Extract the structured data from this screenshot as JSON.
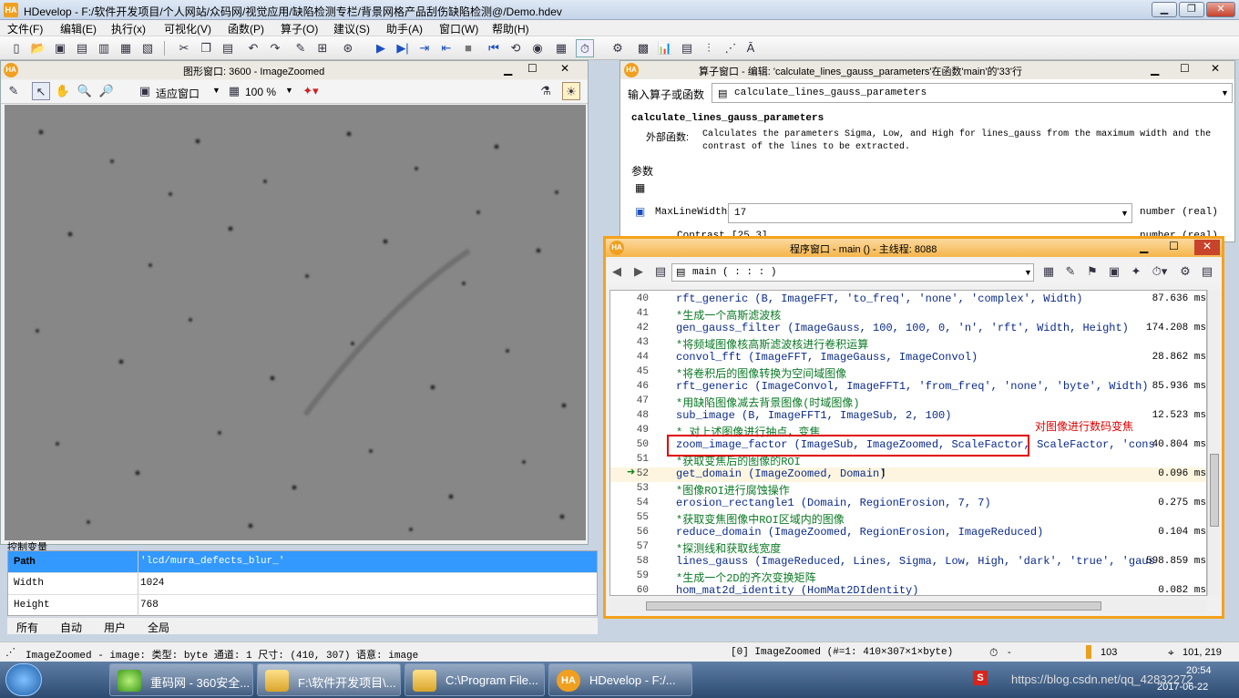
{
  "app": {
    "title": "HDevelop - F:/软件开发项目/个人网站/众码网/视觉应用/缺陷检测专栏/背景网格产品刮伤缺陷检测@/Demo.hdev",
    "logo": "HA"
  },
  "menu": [
    "文件(F)",
    "编辑(E)",
    "执行(x)",
    "可视化(V)",
    "函数(P)",
    "算子(O)",
    "建议(S)",
    "助手(A)",
    "窗口(W)",
    "帮助(H)"
  ],
  "graphics_window": {
    "title": "图形窗口: 3600 - ImageZoomed",
    "fit_label": "适应窗口",
    "zoom_label": "100 %"
  },
  "variables": {
    "rows": [
      {
        "key": "Path",
        "value": "'lcd/mura_defects_blur_'"
      },
      {
        "key": "Width",
        "value": "1024"
      },
      {
        "key": "Height",
        "value": "768"
      }
    ],
    "tabs": [
      "所有",
      "自动",
      "用户",
      "全局"
    ],
    "section_label": "控制变量"
  },
  "operator_window": {
    "title": "算子窗口 - 编辑: 'calculate_lines_gauss_parameters'在函数'main'的'33'行",
    "input_label": "输入算子或函数",
    "input_value": "calculate_lines_gauss_parameters",
    "operator_name": "calculate_lines_gauss_parameters",
    "external_label": "外部函数:",
    "description": "Calculates the parameters Sigma, Low, and High for lines_gauss from the maximum width and the contrast of the lines to be extracted.",
    "params_label": "参数",
    "params": [
      {
        "name": "MaxLineWidth",
        "value": "17",
        "type": "number (real)"
      },
      {
        "name": "Contrast",
        "value": "[25,3]",
        "type": "number (real)"
      }
    ]
  },
  "program_window": {
    "title": "程序窗口 - main () - 主线程: 8088",
    "procedure": "main ( : : : )",
    "lines": [
      {
        "n": "40",
        "text": "rft_generic (B, ImageFFT, 'to_freq', 'none', 'complex', Width)",
        "comment": false,
        "time": "87.636 ms"
      },
      {
        "n": "41",
        "text": "*生成一个高斯滤波核",
        "comment": true,
        "time": ""
      },
      {
        "n": "42",
        "text": "gen_gauss_filter (ImageGauss, 100, 100, 0, 'n', 'rft', Width, Height)",
        "comment": false,
        "time": "174.208 ms"
      },
      {
        "n": "43",
        "text": "*将频域图像核高斯滤波核进行卷积运算",
        "comment": true,
        "time": ""
      },
      {
        "n": "44",
        "text": "convol_fft (ImageFFT, ImageGauss, ImageConvol)",
        "comment": false,
        "time": "28.862 ms"
      },
      {
        "n": "45",
        "text": "*将卷积后的图像转换为空间域图像",
        "comment": true,
        "time": ""
      },
      {
        "n": "46",
        "text": "rft_generic (ImageConvol, ImageFFT1, 'from_freq', 'none', 'byte', Width)",
        "comment": false,
        "time": "85.936 ms"
      },
      {
        "n": "47",
        "text": "*用缺陷图像减去背景图像(时域图像)",
        "comment": true,
        "time": ""
      },
      {
        "n": "48",
        "text": "sub_image (B, ImageFFT1, ImageSub, 2, 100)",
        "comment": false,
        "time": "12.523 ms"
      },
      {
        "n": "49",
        "text": "* 对上述图像进行抽点，变焦",
        "comment": true,
        "time": ""
      },
      {
        "n": "50",
        "text": "zoom_image_factor (ImageSub, ImageZoomed, ScaleFactor, ScaleFactor, 'cons",
        "comment": false,
        "time": "40.804 ms"
      },
      {
        "n": "51",
        "text": "*获取变焦后的图像的ROI",
        "comment": true,
        "time": ""
      },
      {
        "n": "52",
        "text": "get_domain (ImageZoomed, Domain)",
        "comment": false,
        "time": "0.096 ms"
      },
      {
        "n": "53",
        "text": "*图像ROI进行腐蚀操作",
        "comment": true,
        "time": ""
      },
      {
        "n": "54",
        "text": "erosion_rectangle1 (Domain, RegionErosion, 7, 7)",
        "comment": false,
        "time": "0.275 ms"
      },
      {
        "n": "55",
        "text": "*获取变焦图像中ROI区域内的图像",
        "comment": true,
        "time": ""
      },
      {
        "n": "56",
        "text": "reduce_domain (ImageZoomed, RegionErosion, ImageReduced)",
        "comment": false,
        "time": "0.104 ms"
      },
      {
        "n": "57",
        "text": "*探测线和获取线宽度",
        "comment": true,
        "time": ""
      },
      {
        "n": "58",
        "text": "lines_gauss (ImageReduced, Lines, Sigma, Low, High, 'dark', 'true', 'gaus",
        "comment": false,
        "time": "598.859 ms"
      },
      {
        "n": "59",
        "text": "*生成一个2D的齐次变换矩阵",
        "comment": true,
        "time": ""
      },
      {
        "n": "60",
        "text": "hom_mat2d_identity (HomMat2DIdentity)",
        "comment": false,
        "time": "0.082 ms"
      }
    ],
    "annotation": "对图像进行数码变焦",
    "annotation_color": "#e00000"
  },
  "status": {
    "left": "ImageZoomed - image: 类型: byte 通道: 1 尺寸: (410, 307) 语意: image",
    "middle": "[0] ImageZoomed (#=1: 410×307×1×byte)",
    "timer": "-",
    "count": "103",
    "coords": "101, 219"
  },
  "taskbar": {
    "items": [
      "重码网 - 360安全...",
      "F:\\软件开发项目\\...",
      "C:\\Program File...",
      "HDevelop - F:/..."
    ],
    "clock_time": "20:54",
    "clock_date": "2017-06-22",
    "watermark": "https://blog.csdn.net/qq_42832272"
  }
}
